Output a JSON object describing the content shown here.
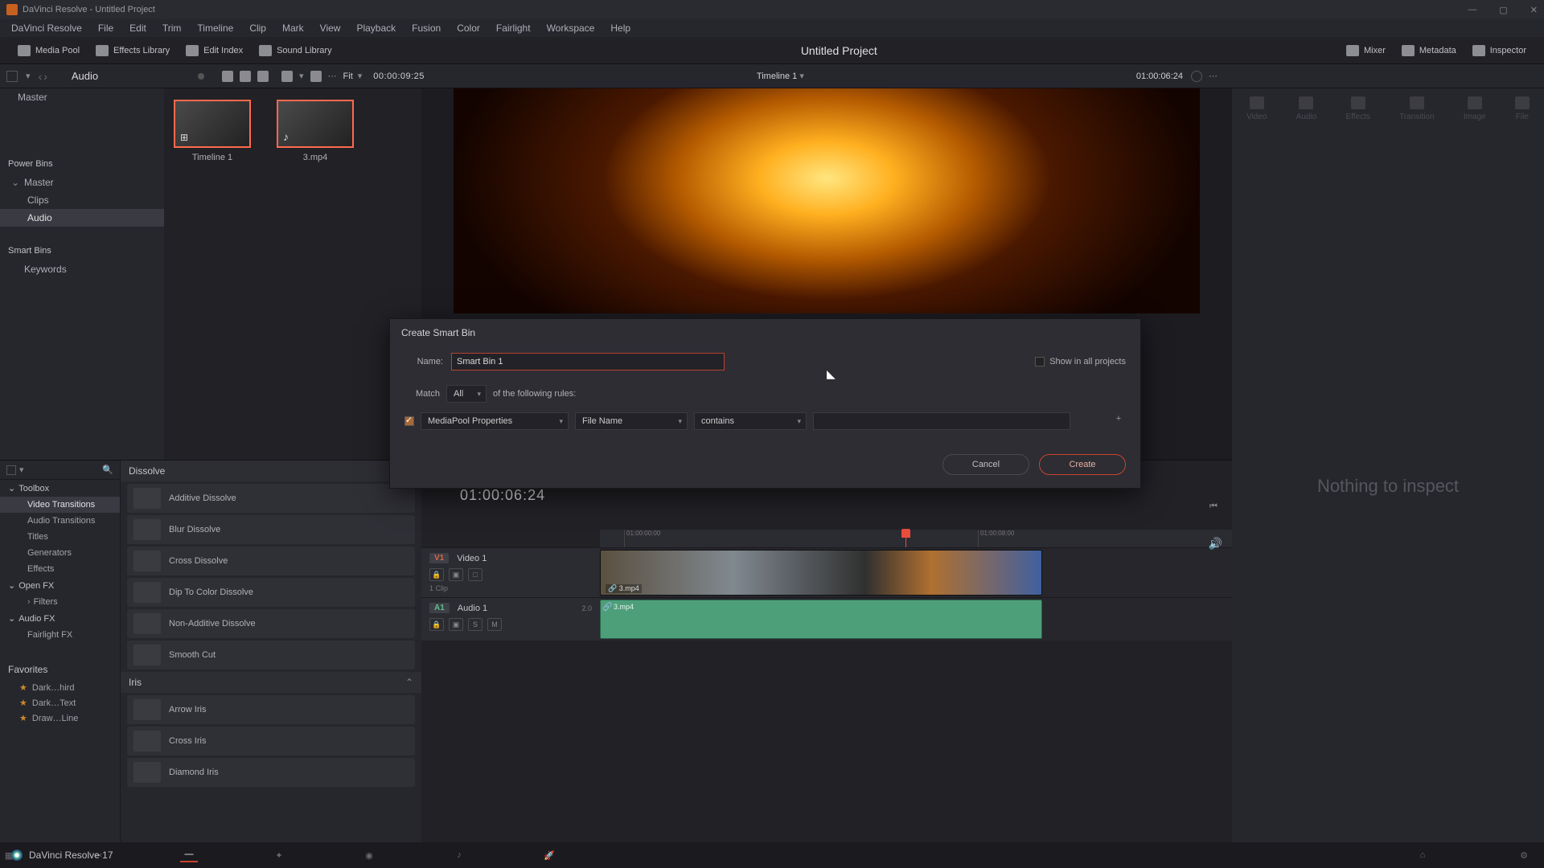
{
  "window": {
    "title": "DaVinci Resolve - Untitled Project"
  },
  "menu": [
    "DaVinci Resolve",
    "File",
    "Edit",
    "Trim",
    "Timeline",
    "Clip",
    "Mark",
    "View",
    "Playback",
    "Fusion",
    "Color",
    "Fairlight",
    "Workspace",
    "Help"
  ],
  "topbuttons": {
    "media_pool": "Media Pool",
    "effects_library": "Effects Library",
    "edit_index": "Edit Index",
    "sound_library": "Sound Library",
    "mixer": "Mixer",
    "metadata": "Metadata",
    "inspector": "Inspector"
  },
  "project_title": "Untitled Project",
  "bin_header": {
    "selected": "Audio"
  },
  "viewer": {
    "fit": "Fit",
    "left_tc": "00:00:09:25",
    "name": "Timeline 1",
    "right_tc": "01:00:06:24"
  },
  "bins": {
    "master": "Master",
    "power": "Power Bins",
    "power_master": "Master",
    "clips": "Clips",
    "audio": "Audio",
    "smart": "Smart Bins",
    "keywords": "Keywords"
  },
  "thumbs": {
    "t1": "Timeline 1",
    "t2": "3.mp4"
  },
  "inspector": {
    "tabs": [
      "Video",
      "Audio",
      "Effects",
      "Transition",
      "Image",
      "File"
    ],
    "nothing": "Nothing to inspect"
  },
  "fx": {
    "toolbox": "Toolbox",
    "side": {
      "video_tr": "Video Transitions",
      "audio_tr": "Audio Transitions",
      "titles": "Titles",
      "generators": "Generators",
      "effects": "Effects"
    },
    "openfx": "Open FX",
    "filters": "Filters",
    "audiofx": "Audio FX",
    "fairlight": "Fairlight FX",
    "favorites": "Favorites",
    "favs": [
      "Dark…hird",
      "Dark…Text",
      "Draw…Line"
    ],
    "cat_dissolve": "Dissolve",
    "dissolve_items": [
      "Additive Dissolve",
      "Blur Dissolve",
      "Cross Dissolve",
      "Dip To Color Dissolve",
      "Non-Additive Dissolve",
      "Smooth Cut"
    ],
    "cat_iris": "Iris",
    "iris_items": [
      "Arrow Iris",
      "Cross Iris",
      "Diamond Iris"
    ]
  },
  "timeline": {
    "bigtc": "01:00:06:24",
    "ruler": [
      "01:00:00:00",
      "01:00:08:00"
    ],
    "v1": {
      "badge": "V1",
      "name": "Video 1",
      "sub": "1 Clip"
    },
    "a1": {
      "badge": "A1",
      "name": "Audio 1",
      "ch": "2.0"
    },
    "clip_v": "3.mp4",
    "clip_a": "3.mp4",
    "btns": {
      "lock": "🔒",
      "eye": "▢",
      "auto": "□",
      "solo": "S",
      "mute": "M"
    }
  },
  "modal": {
    "title": "Create Smart Bin",
    "name_label": "Name:",
    "name_value": "Smart Bin 1",
    "show_all": "Show in all projects",
    "match": "Match",
    "match_mode": "All",
    "match_suffix": "of the following rules:",
    "prop": "MediaPool Properties",
    "field": "File Name",
    "op": "contains",
    "cancel": "Cancel",
    "create": "Create"
  },
  "brand": "DaVinci Resolve 17"
}
